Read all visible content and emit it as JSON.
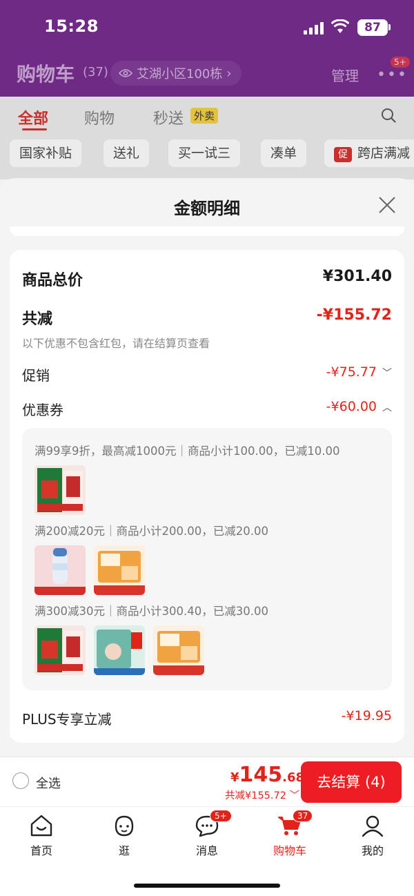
{
  "status_bar": {
    "time": "15:28",
    "battery": "87"
  },
  "header": {
    "title": "购物车",
    "count": "(37)",
    "address": "艾湖小区100栋",
    "manage": "管理",
    "more_badge": "5+"
  },
  "tabs": [
    {
      "label": "全部"
    },
    {
      "label": "购物"
    },
    {
      "label": "秒送"
    }
  ],
  "waimai_badge": "外卖",
  "chips": [
    "国家补贴",
    "送礼",
    "买一试三",
    "凑单",
    "跨店满减"
  ],
  "promo_tag": "促",
  "sheet": {
    "title": "金额明细",
    "total_label": "商品总价",
    "total_value": "¥301.40",
    "discount_label": "共减",
    "discount_value": "-¥155.72",
    "discount_note": "以下优惠不包含红包，请在结算页查看",
    "promo_label": "促销",
    "promo_value": "-¥75.77",
    "coupon_label": "优惠券",
    "coupon_value": "-¥60.00",
    "coupon_lines": [
      "满99享9折，最高减1000元｜商品小计100.00，已减10.00",
      "满200减20元｜商品小计200.00，已减20.00",
      "满300减30元｜商品小计300.40，已减30.00"
    ],
    "plus_label": "PLUS专享立减",
    "plus_value": "-¥19.95"
  },
  "bottom_bar": {
    "select_all": "全选",
    "price_currency": "¥",
    "price_int": "145",
    "price_dec": ".68",
    "saved": "共减¥155.72",
    "checkout": "去结算 (4)"
  },
  "nav": [
    {
      "label": "首页"
    },
    {
      "label": "逛"
    },
    {
      "label": "消息",
      "badge": "5+"
    },
    {
      "label": "购物车",
      "badge": "37"
    },
    {
      "label": "我的"
    }
  ],
  "colors": {
    "header_purple": "#6f2a86",
    "accent_red": "#e2231a",
    "checkout_red": "#ee1d24"
  }
}
